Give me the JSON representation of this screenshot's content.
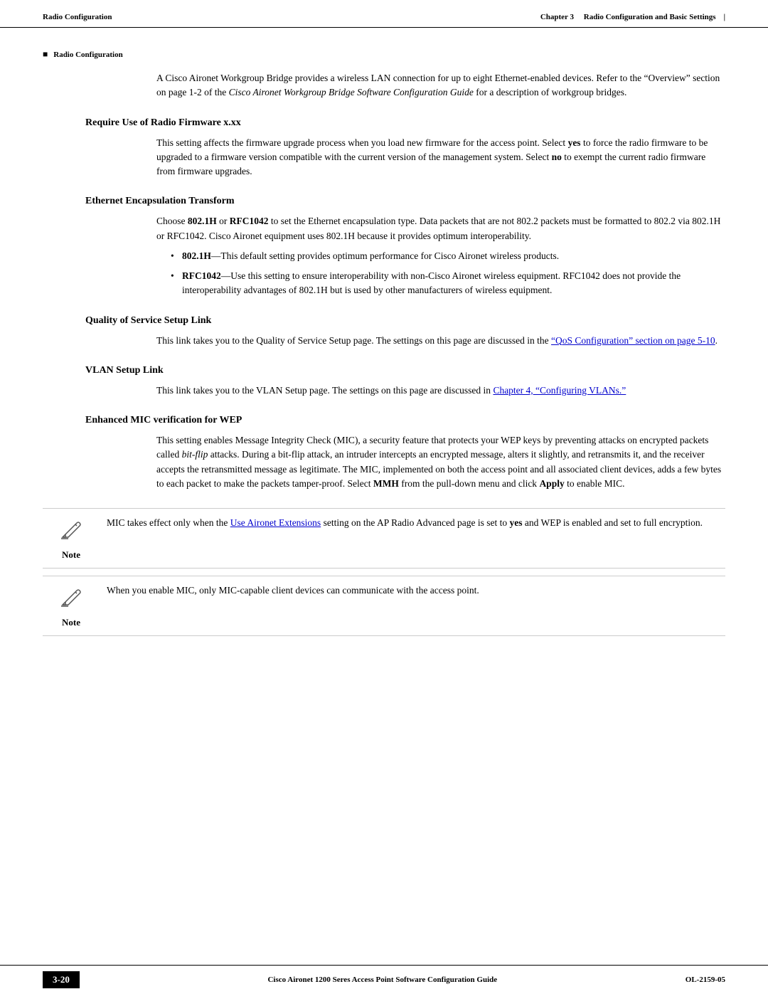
{
  "header": {
    "left_label": "Radio Configuration",
    "chapter_text": "Chapter 3",
    "right_text": "Radio Configuration and Basic Settings"
  },
  "breadcrumb": {
    "bullet": "■",
    "text": "Radio Configuration"
  },
  "intro": {
    "paragraph1": "A Cisco Aironet Workgroup Bridge provides a wireless LAN connection for up to eight Ethernet-enabled devices. Refer to the “Overview” section on page 1-2 of the ",
    "italic_text": "Cisco Aironet Workgroup Bridge Software Configuration Guide",
    "paragraph1_end": " for a description of workgroup bridges."
  },
  "sections": [
    {
      "id": "require-firmware",
      "heading": "Require Use of Radio Firmware x.xx",
      "body": "This setting affects the firmware upgrade process when you load new firmware for the access point. Select yes to force the radio firmware to be upgraded to a firmware version compatible with the current version of the management system. Select no to exempt the current radio firmware from firmware upgrades.",
      "bold_words": [
        "yes",
        "no"
      ]
    },
    {
      "id": "ethernet-encap",
      "heading": "Ethernet Encapsulation Transform",
      "intro": "Choose 802.1H or RFC1042 to set the Ethernet encapsulation type. Data packets that are not 802.2 packets must be formatted to 802.2 via 802.1H or RFC1042. Cisco Aironet equipment uses 802.1H because it provides optimum interoperability.",
      "bullets": [
        "802.1H—This default setting provides optimum performance for Cisco Aironet wireless products.",
        "RFC1042—Use this setting to ensure interoperability with non-Cisco Aironet wireless equipment. RFC1042 does not provide the interoperability advantages of 802.1H but is used by other manufacturers of wireless equipment."
      ]
    },
    {
      "id": "qos-link",
      "heading": "Quality of Service Setup Link",
      "body": "This link takes you to the Quality of Service Setup page. The settings on this page are discussed in the ",
      "link_text": "“QoS Configuration” section on page 5-10",
      "body_end": "."
    },
    {
      "id": "vlan-link",
      "heading": "VLAN Setup Link",
      "body": "This link takes you to the VLAN Setup page. The settings on this page are discussed in ",
      "link_text": "Chapter 4, “Configuring VLANs.”",
      "body_end": ""
    },
    {
      "id": "enhanced-mic",
      "heading": "Enhanced MIC verification for WEP",
      "body": "This setting enables Message Integrity Check (MIC), a security feature that protects your WEP keys by preventing attacks on encrypted packets called bit-flip attacks. During a bit-flip attack, an intruder intercepts an encrypted message, alters it slightly, and retransmits it, and the receiver accepts the retransmitted message as legitimate. The MIC, implemented on both the access point and all associated client devices, adds a few bytes to each packet to make the packets tamper-proof. Select MMH from the pull-down menu and click Apply to enable MIC.",
      "italic_words": [
        "bit-flip"
      ],
      "bold_words": [
        "MMH",
        "Apply"
      ]
    }
  ],
  "notes": [
    {
      "id": "note1",
      "text_before": "MIC takes effect only when the ",
      "link_text": "Use Aironet Extensions",
      "text_after": " setting on the AP Radio Advanced page is set to yes and WEP is enabled and set to full encryption.",
      "bold_words": [
        "yes"
      ]
    },
    {
      "id": "note2",
      "text": "When you enable MIC, only MIC-capable client devices can communicate with the access point."
    }
  ],
  "footer": {
    "page_num": "3-20",
    "title": "Cisco Aironet 1200 Seres Access Point Software Configuration Guide",
    "code": "OL-2159-05"
  }
}
